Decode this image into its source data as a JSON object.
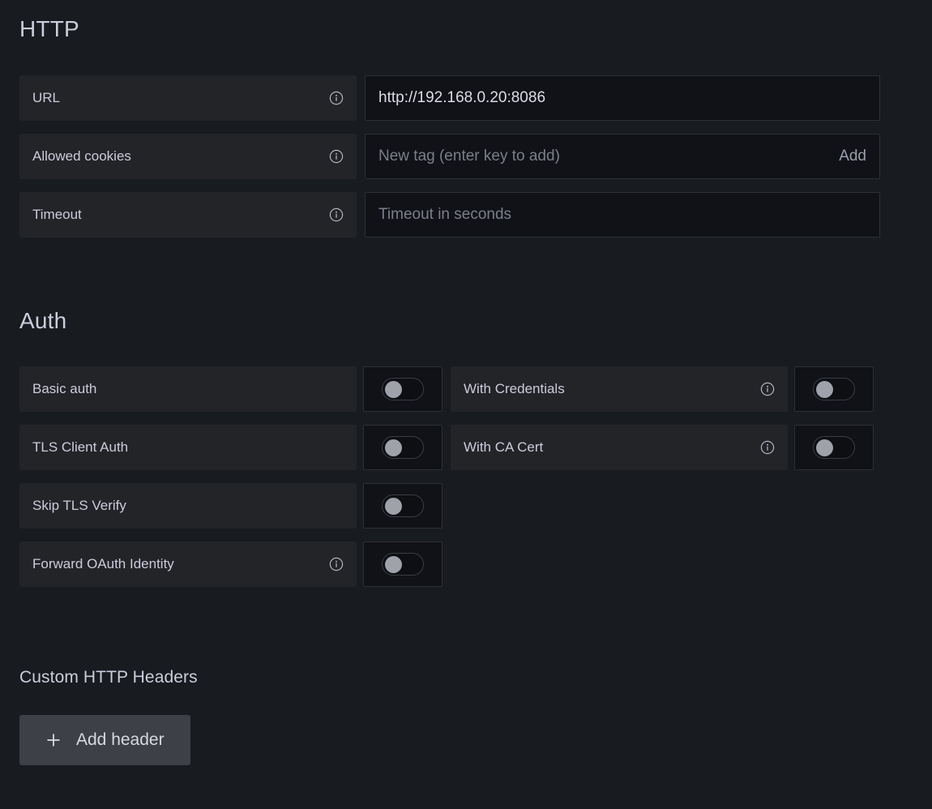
{
  "sections": {
    "http": {
      "title": "HTTP",
      "fields": [
        {
          "label": "URL",
          "info_icon": "info-circle-icon",
          "input_value": "http://192.168.0.20:8086",
          "input_placeholder": ""
        },
        {
          "label": "Allowed cookies",
          "info_icon": "info-circle-icon",
          "input_value": "",
          "input_placeholder": "New tag (enter key to add)",
          "add_label": "Add"
        },
        {
          "label": "Timeout",
          "info_icon": "info-circle-icon",
          "input_value": "",
          "input_placeholder": "Timeout in seconds"
        }
      ]
    },
    "auth": {
      "title": "Auth",
      "left_column": [
        {
          "label": "Basic auth",
          "has_info": false,
          "toggle_on": false
        },
        {
          "label": "TLS Client Auth",
          "has_info": false,
          "toggle_on": false
        },
        {
          "label": "Skip TLS Verify",
          "has_info": false,
          "toggle_on": false
        },
        {
          "label": "Forward OAuth Identity",
          "has_info": true,
          "info_icon": "info-circle-icon",
          "toggle_on": false
        }
      ],
      "right_column": [
        {
          "label": "With Credentials",
          "has_info": true,
          "info_icon": "info-circle-icon",
          "toggle_on": false
        },
        {
          "label": "With CA Cert",
          "has_info": true,
          "info_icon": "info-circle-icon",
          "toggle_on": false
        }
      ]
    },
    "custom_headers": {
      "title": "Custom HTTP Headers",
      "add_button": {
        "label": "Add header",
        "icon": "plus-icon"
      }
    }
  },
  "colors": {
    "page_background": "#181b1f",
    "label_background": "#232428",
    "input_background": "#111217",
    "input_border": "#2e3036",
    "text_primary": "#ccccdc",
    "text_placeholder": "#7b7f8b",
    "toggle_knob": "#9fa1ab",
    "button_background": "#3d4047"
  }
}
